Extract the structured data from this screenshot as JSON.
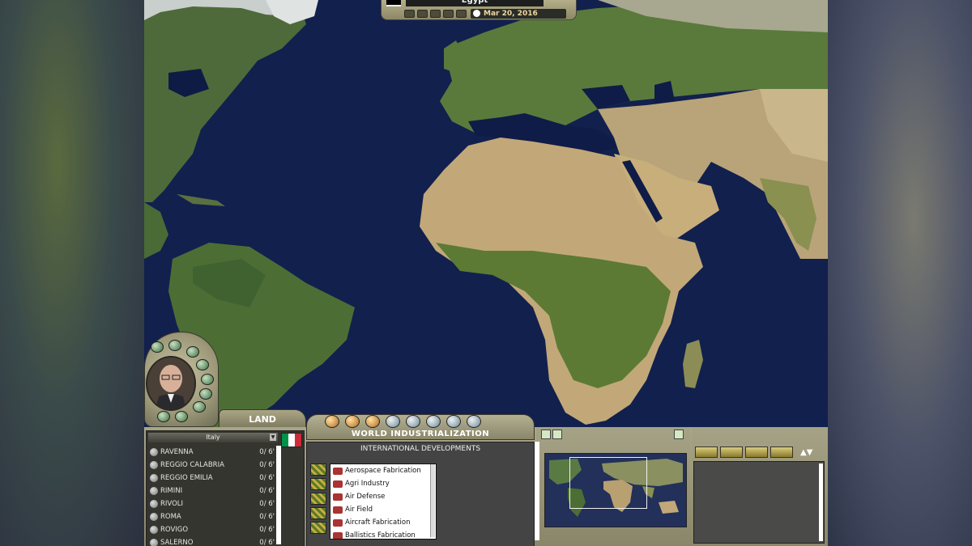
{
  "top_bar": {
    "country": "Egypt",
    "date": "Mar 20, 2016"
  },
  "advisor": {
    "tab_label": "LAND"
  },
  "city_panel": {
    "selected_country": "Italy",
    "cities": [
      {
        "name": "RAVENNA",
        "count": "0/ 6'"
      },
      {
        "name": "REGGIO CALABRIA",
        "count": "0/ 6'"
      },
      {
        "name": "REGGIO EMILIA",
        "count": "0/ 6'"
      },
      {
        "name": "RIMINI",
        "count": "0/ 6'"
      },
      {
        "name": "RIVOLI",
        "count": "0/ 6'"
      },
      {
        "name": "ROMA",
        "count": "0/ 6'"
      },
      {
        "name": "ROVIGO",
        "count": "0/ 6'"
      },
      {
        "name": "SALERNO",
        "count": "0/ 6'"
      }
    ]
  },
  "industrialization": {
    "tab_title": "WORLD INDUSTRIALIZATION",
    "panel_title": "INTERNATIONAL DEVELOPMENTS",
    "developments": [
      "Aerospace Fabrication",
      "Agri Industry",
      "Air Defense",
      "Air Field",
      "Aircraft Fabrication",
      "Ballistics Fabrication"
    ]
  },
  "colors": {
    "ocean": "#12204e",
    "panel_tan": "#a9a688",
    "italy_flag": [
      "#009246",
      "#ffffff",
      "#ce2b37"
    ]
  }
}
